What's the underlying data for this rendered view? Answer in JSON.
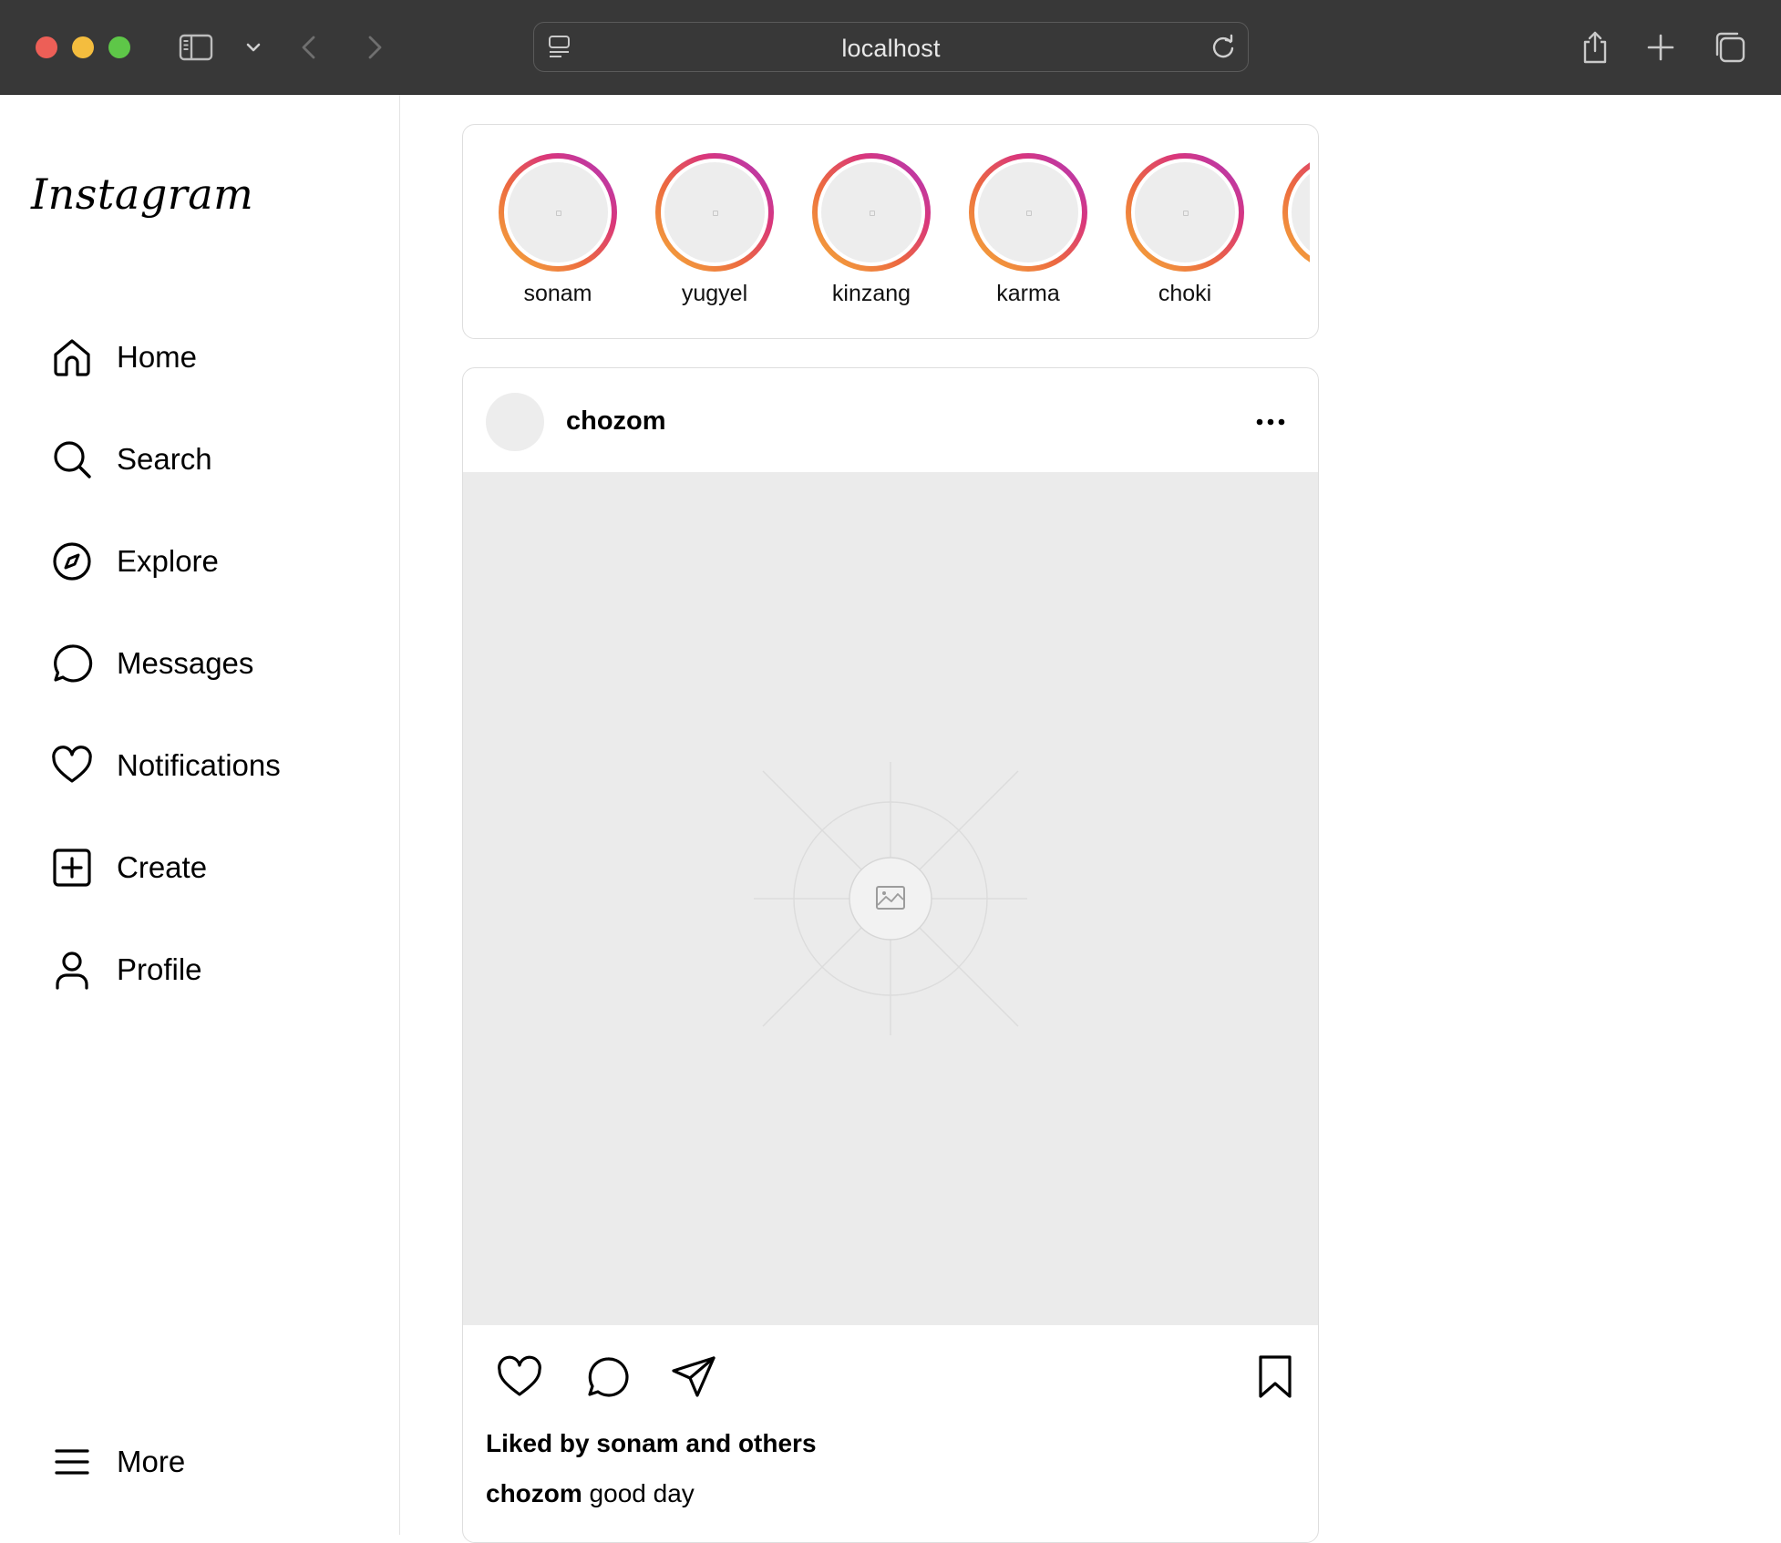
{
  "browser": {
    "url": "localhost",
    "icons": [
      "sidebar-toggle-icon",
      "chevron-down-icon",
      "back-arrow-icon",
      "forward-arrow-icon",
      "page-icon",
      "reload-icon",
      "share-icon",
      "new-tab-icon",
      "tabs-overview-icon"
    ]
  },
  "sidebar": {
    "logo": "Instagram",
    "items": [
      {
        "label": "Home",
        "icon": "home-icon"
      },
      {
        "label": "Search",
        "icon": "search-icon"
      },
      {
        "label": "Explore",
        "icon": "compass-icon"
      },
      {
        "label": "Messages",
        "icon": "message-bubble-icon"
      },
      {
        "label": "Notifications",
        "icon": "heart-icon"
      },
      {
        "label": "Create",
        "icon": "plus-square-icon"
      },
      {
        "label": "Profile",
        "icon": "user-icon"
      }
    ],
    "more_label": "More"
  },
  "stories": [
    {
      "name": "sonam"
    },
    {
      "name": "yugyel"
    },
    {
      "name": "kinzang"
    },
    {
      "name": "karma"
    },
    {
      "name": "choki"
    }
  ],
  "post": {
    "username": "chozom",
    "liked_by": "Liked by sonam and others",
    "caption_user": "chozom",
    "caption_text": " good day"
  },
  "colors": {
    "story_ring_start": "#f5b03a",
    "story_ring_end": "#a73cc7",
    "placeholder_bg": "#ebebeb"
  }
}
